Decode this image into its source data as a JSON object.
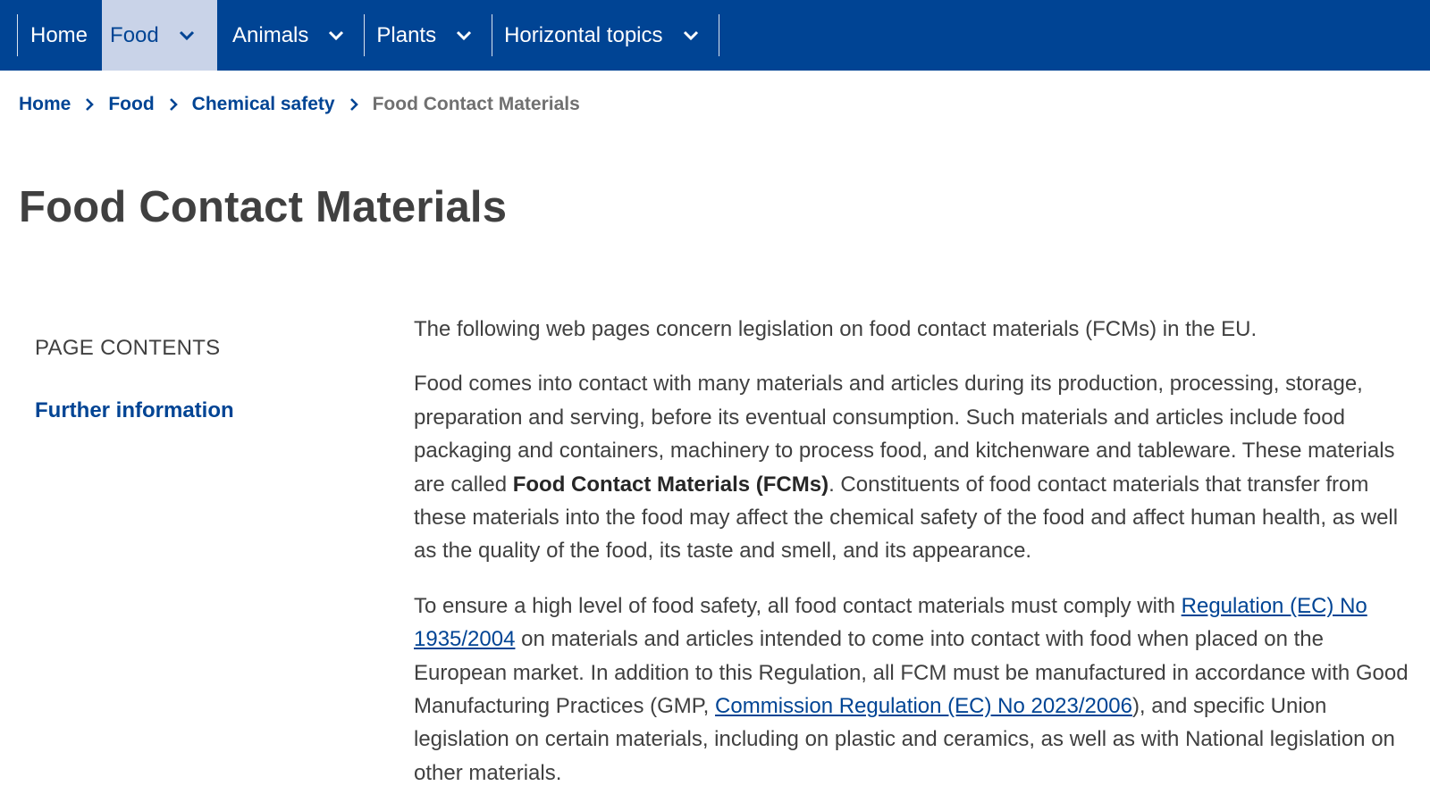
{
  "nav": {
    "home": "Home",
    "items": [
      {
        "label": "Food",
        "active": true
      },
      {
        "label": "Animals",
        "active": false
      },
      {
        "label": "Plants",
        "active": false
      },
      {
        "label": "Horizontal topics",
        "active": false
      }
    ]
  },
  "breadcrumb": {
    "items": [
      "Home",
      "Food",
      "Chemical safety"
    ],
    "current": "Food Contact Materials"
  },
  "page": {
    "title": "Food Contact Materials"
  },
  "sidebar": {
    "heading": "PAGE CONTENTS",
    "links": [
      "Further information"
    ]
  },
  "content": {
    "p1": "The following web pages concern legislation on food contact materials (FCMs) in the EU.",
    "p2_a": "Food comes into contact with many materials and articles during its production, processing, storage, preparation and serving, before its eventual consumption. Such materials and articles include food packaging and containers, machinery to process food, and kitchenware and tableware. These materials are called ",
    "p2_bold": "Food Contact Materials (FCMs)",
    "p2_b": ". Constituents of food contact materials that transfer from these materials into the food may affect the chemical safety of the food and affect human health, as well as the quality of the food, its taste and smell, and its appearance.",
    "p3_a": "To ensure a high level of food safety, all food contact materials must comply with ",
    "p3_link1": "Regulation (EC) No 1935/2004",
    "p3_b": " on materials and articles intended to come into contact with food when placed on the European market. In addition to this Regulation, all FCM must be manufactured in accordance with Good Manufacturing Practices (GMP, ",
    "p3_link2": "Commission Regulation (EC) No 2023/2006",
    "p3_c": "), and specific Union legislation on certain materials, including on plastic and ceramics, as well as with National legislation on other materials."
  },
  "colors": {
    "nav_bg": "#004494",
    "nav_active_bg": "#c9d3e8",
    "link": "#004494",
    "text": "#404040"
  },
  "icons": {
    "nav_dropdown": "chevron-down-icon",
    "breadcrumb_separator": "chevron-right-icon"
  }
}
